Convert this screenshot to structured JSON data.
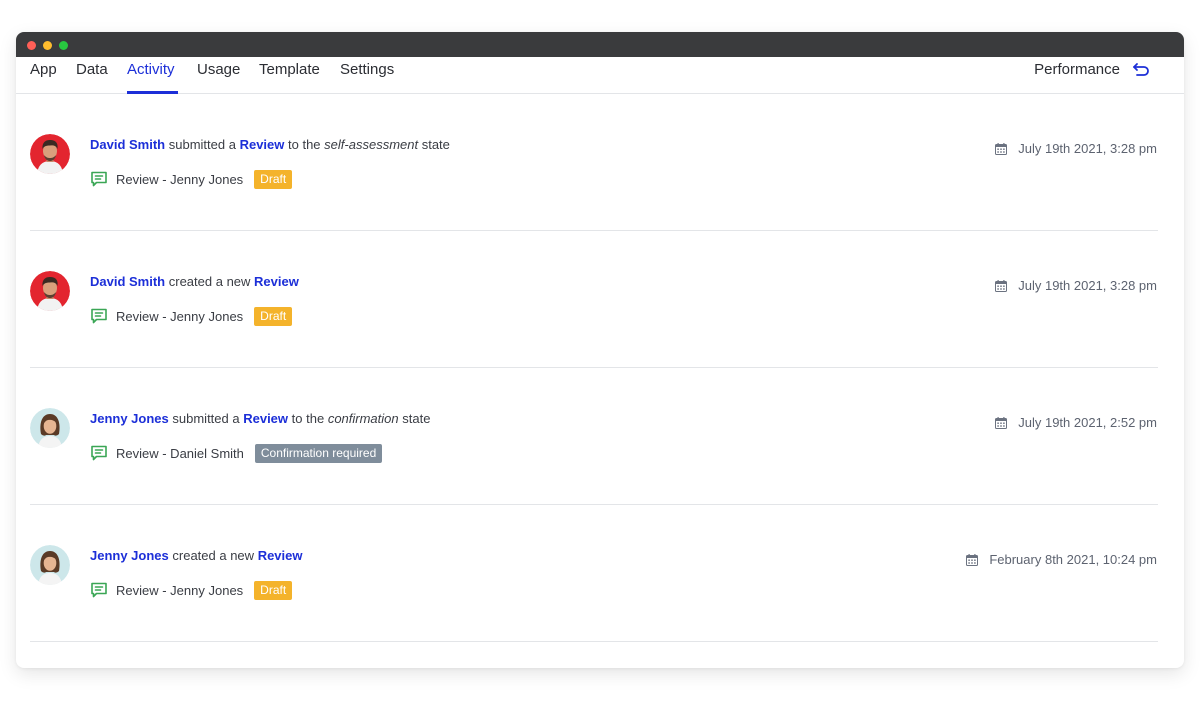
{
  "tabs": [
    {
      "label": "App"
    },
    {
      "label": "Data"
    },
    {
      "label": "Activity",
      "active": true
    },
    {
      "label": "Usage"
    },
    {
      "label": "Template"
    },
    {
      "label": "Settings"
    }
  ],
  "performance_label": "Performance",
  "colors": {
    "accent": "#1c2fd8",
    "draft": "#f4b32b",
    "confirmation": "#7f8d9b",
    "doc_icon": "#3aa655"
  },
  "activities": [
    {
      "actor": "David Smith",
      "verb": "submitted a",
      "object": "Review",
      "prep": "to the",
      "state": "self-assessment",
      "suffix": "state",
      "document": "Review - Jenny Jones",
      "badge": "Draft",
      "date": "July 19th 2021, 3:28 pm",
      "avatar": "male-avatar"
    },
    {
      "actor": "David Smith",
      "verb": "created a new",
      "object": "Review",
      "document": "Review - Jenny Jones",
      "badge": "Draft",
      "date": "July 19th 2021, 3:28 pm",
      "avatar": "male-avatar"
    },
    {
      "actor": "Jenny Jones",
      "verb": "submitted a",
      "object": "Review",
      "prep": "to the",
      "state": "confirmation",
      "suffix": "state",
      "document": "Review - Daniel Smith",
      "badge": "Confirmation required",
      "date": "July 19th 2021, 2:52 pm",
      "avatar": "female-avatar"
    },
    {
      "actor": "Jenny Jones",
      "verb": "created a new",
      "object": "Review",
      "document": "Review - Jenny Jones",
      "badge": "Draft",
      "date": "February 8th 2021, 10:24 pm",
      "avatar": "female-avatar"
    }
  ]
}
